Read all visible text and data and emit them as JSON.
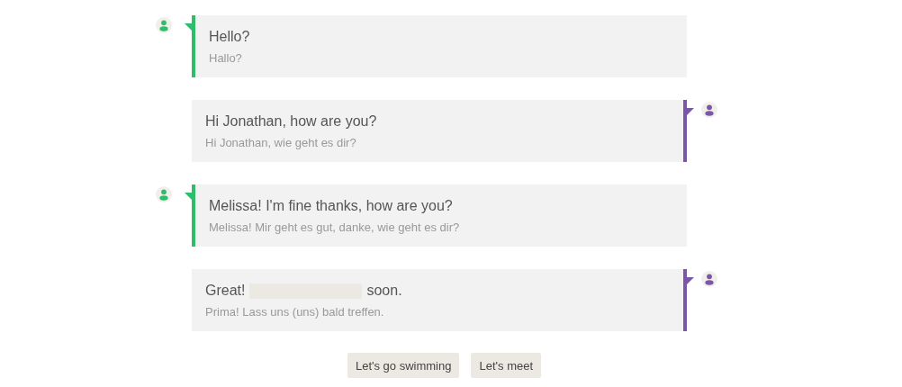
{
  "messages": [
    {
      "kind": "left",
      "segments": [
        {
          "kind": "text",
          "text": "Hello?"
        }
      ],
      "translation": "Hallo?"
    },
    {
      "kind": "right",
      "segments": [
        {
          "kind": "text",
          "text": "Hi Jonathan, how are you?"
        }
      ],
      "translation": "Hi Jonathan, wie geht es dir?"
    },
    {
      "kind": "left",
      "segments": [
        {
          "kind": "text",
          "text": "Melissa! I'm fine thanks, how are you?"
        }
      ],
      "translation": "Melissa! Mir geht es gut, danke, wie geht es dir?"
    },
    {
      "kind": "right",
      "segments": [
        {
          "kind": "text",
          "text": "Great!"
        },
        {
          "kind": "blank"
        },
        {
          "kind": "text",
          "text": "soon."
        }
      ],
      "translation": "Prima! Lass uns (uns) bald treffen."
    }
  ],
  "answer_options": [
    "Let's go swimming",
    "Let's meet"
  ]
}
